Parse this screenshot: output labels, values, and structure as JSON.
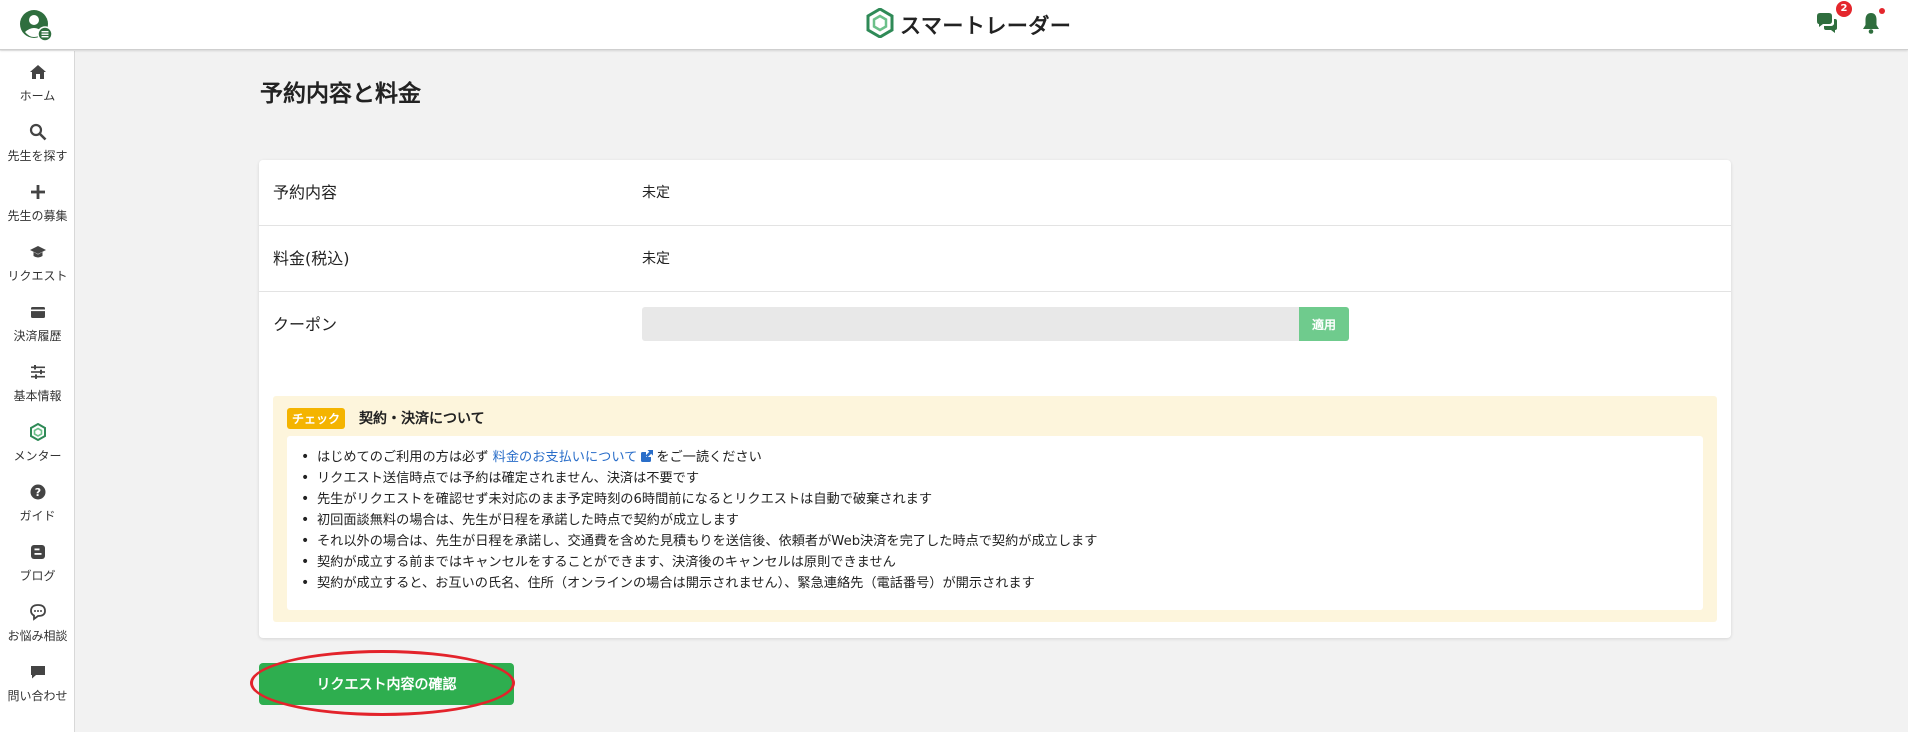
{
  "header": {
    "logo_text": "スマートレーダー",
    "chat_badge": "2",
    "icons": [
      "user-menu-icon",
      "logo-hexagon-icon",
      "chat-icon",
      "bell-icon"
    ],
    "brand_color": "#2eae4f"
  },
  "sidebar": {
    "items": [
      {
        "label": "ホーム",
        "icon": "home-icon"
      },
      {
        "label": "先生を探す",
        "icon": "search-icon"
      },
      {
        "label": "先生の募集",
        "icon": "plus-icon"
      },
      {
        "label": "リクエスト",
        "icon": "graduation-cap-icon"
      },
      {
        "label": "決済履歴",
        "icon": "wallet-icon"
      },
      {
        "label": "基本情報",
        "icon": "sliders-icon"
      },
      {
        "label": "メンター",
        "icon": "mentor-hexagon-icon"
      },
      {
        "label": "ガイド",
        "icon": "question-icon"
      },
      {
        "label": "ブログ",
        "icon": "blog-icon"
      },
      {
        "label": "お悩み相談",
        "icon": "speech-bubble-icon"
      },
      {
        "label": "問い合わせ",
        "icon": "message-icon"
      }
    ]
  },
  "main": {
    "title": "予約内容と料金",
    "rows": {
      "reservation": {
        "label": "予約内容",
        "value": "未定"
      },
      "fee": {
        "label": "料金(税込)",
        "value": "未定"
      },
      "coupon": {
        "label": "クーポン",
        "input_value": "",
        "apply_label": "適用"
      }
    },
    "notice": {
      "tag": "チェック",
      "title": "契約・決済について",
      "item1_pre": "はじめてのご利用の方は必ず",
      "item1_link": "料金のお支払いについて",
      "item1_post": "をご一読ください",
      "items": [
        "リクエスト送信時点では予約は確定されません、決済は不要です",
        "先生がリクエストを確認せず未対応のまま予定時刻の6時間前になるとリクエストは自動で破棄されます",
        "初回面談無料の場合は、先生が日程を承諾した時点で契約が成立します",
        "それ以外の場合は、先生が日程を承諾し、交通費を含めた見積もりを送信後、依頼者がWeb決済を完了した時点で契約が成立します",
        "契約が成立する前まではキャンセルをすることができます、決済後のキャンセルは原則できません",
        "契約が成立すると、お互いの氏名、住所（オンラインの場合は開示されません）、緊急連絡先（電話番号）が開示されます"
      ]
    },
    "confirm_button": "リクエスト内容の確認"
  }
}
